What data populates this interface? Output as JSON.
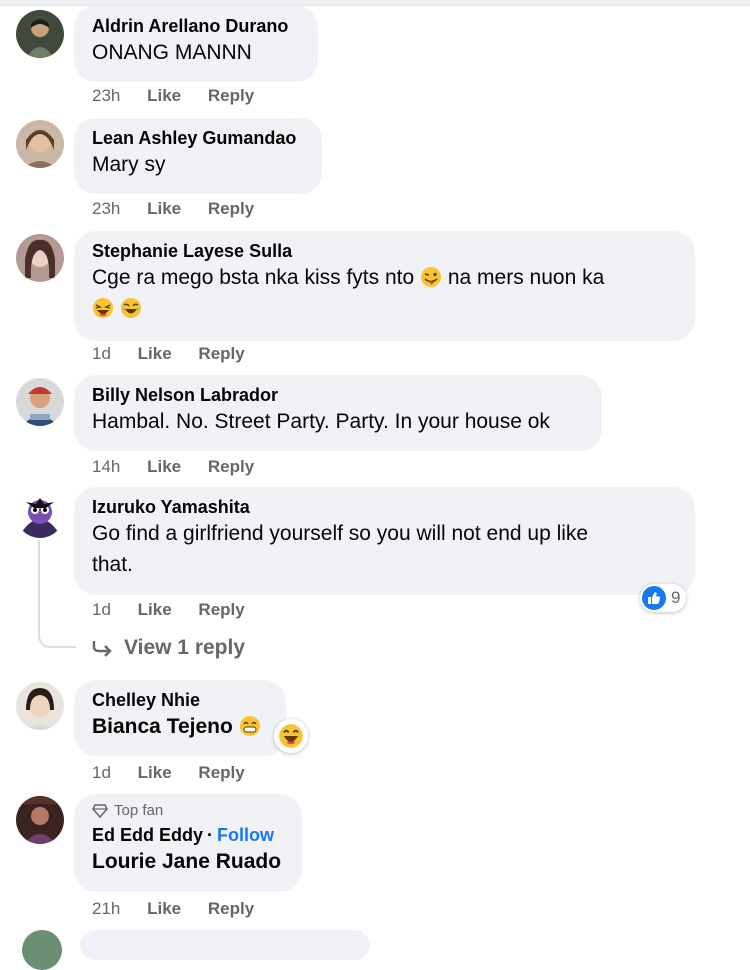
{
  "actions": {
    "like": "Like",
    "reply": "Reply"
  },
  "comments": [
    {
      "author": "Aldrin Arellano Durano",
      "text": "ONANG MANNN",
      "time": "23h"
    },
    {
      "author": "Lean Ashley Gumandao",
      "text": "Mary sy",
      "time": "23h"
    },
    {
      "author": "Stephanie Layese Sulla",
      "text_line1": "Cge ra mego bsta nka kiss fyts nto",
      "text_line1b": "na mers nuon ka",
      "time": "1d"
    },
    {
      "author": "Billy Nelson Labrador",
      "text": "Hambal. No. Street Party. Party. In your house ok",
      "time": "14h"
    },
    {
      "author": "Izuruko Yamashita",
      "text_line1": "Go find a girlfriend yourself so you will not end up like",
      "text_line2": "that.",
      "time": "1d",
      "reaction_count": "9"
    },
    {
      "author": "Chelley Nhie",
      "text": "Bianca Tejeno",
      "time": "1d"
    },
    {
      "badge": "Top fan",
      "author": "Ed Edd Eddy",
      "follow": "Follow",
      "text": "Lourie Jane Ruado",
      "time": "21h"
    }
  ],
  "view_replies": "View 1 reply",
  "icons": {
    "like_reaction": "like-thumb-icon",
    "emoji_tongue": "winking-tongue-emoji",
    "emoji_laugh": "laughing-emoji",
    "emoji_grin": "grinning-emoji",
    "reply_arrow": "reply-arrow-icon",
    "diamond": "diamond-icon"
  },
  "colors": {
    "bubble": "#f0f2f5",
    "meta": "#65676b",
    "link": "#1877f2"
  }
}
